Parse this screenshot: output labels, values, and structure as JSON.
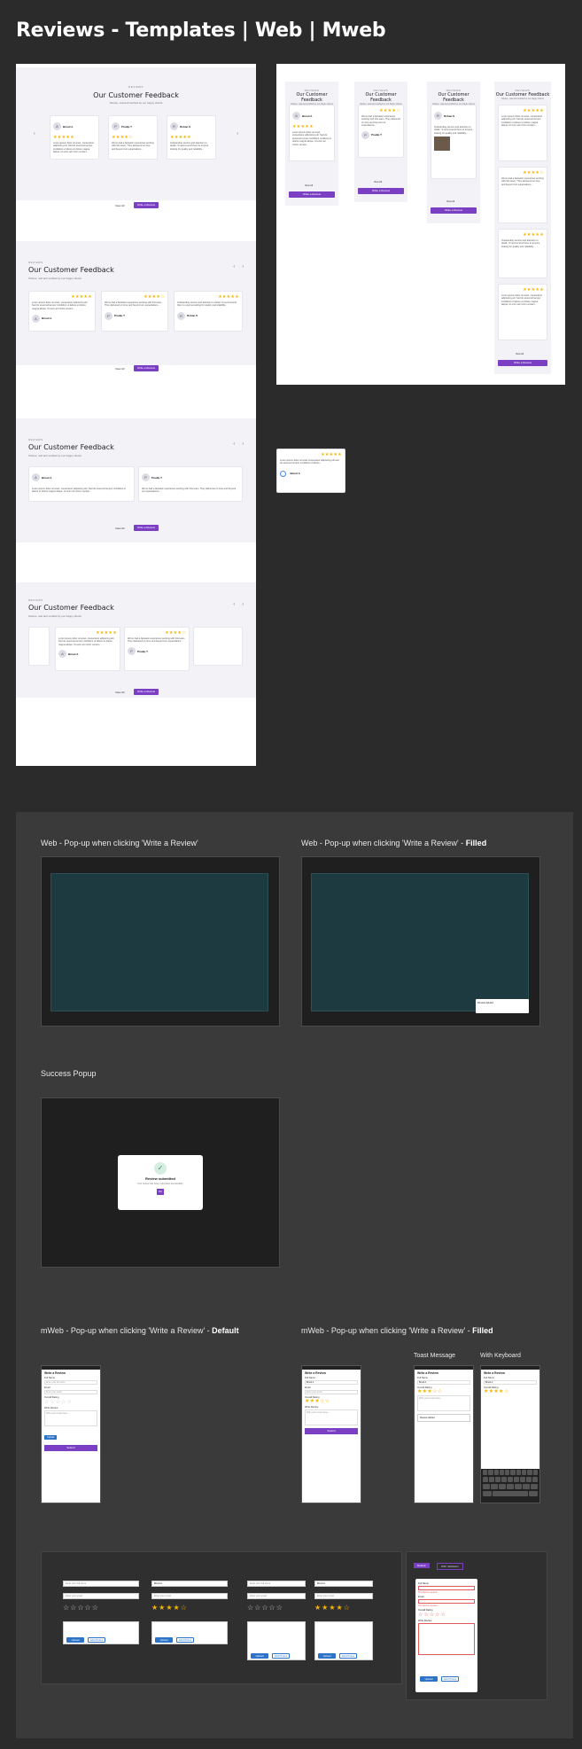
{
  "page": {
    "title": "Reviews - Templates | Web | Mweb"
  },
  "review_block": {
    "eyebrow": "REVIEWS",
    "title": "Our Customer Feedback",
    "subtitle": "Stories, real and verified by our happy clients",
    "view_all": "View All",
    "write_review": "Write a Review",
    "read_more": "Read more"
  },
  "reviewers": [
    {
      "name": "Binod A",
      "initial": "A",
      "rating": "★★★★★",
      "text": "Lorem ipsum dolor sit amet, consectetur adipiscing elit. Sed do eiusmod tempor incididunt ut labore et dolore magna aliqua. Ut enim ad minim veniam..."
    },
    {
      "name": "Pradip T",
      "initial": "P",
      "rating": "★★★★☆",
      "text": "We've had a fantastic experience working with this team. They delivered on time and beyond our expectations..."
    },
    {
      "name": "Rohan S",
      "initial": "R",
      "rating": "★★★★★",
      "text": "Outstanding service and attention to detail. I'd recommend them to anyone looking for quality and reliability..."
    }
  ],
  "google_card": {
    "name": "Binod A",
    "rating": "★★★★★",
    "text": "Lorem ipsum dolor sit amet consectetur adipiscing elit sed do eiusmod tempor incididunt ut labore..."
  },
  "dark_section": {
    "popup_default_label": "Web - Pop-up when clicking 'Write a Review'",
    "popup_filled_label": "Web - Pop-up when clicking 'Write a Review' - ",
    "filled_word": "Filled",
    "success_label": "Success Popup",
    "success_title": "Review submitted",
    "success_text": "Your review has been submitted successfully.",
    "success_ok": "OK",
    "mweb_default_label": "mWeb - Pop-up when clicking 'Write a Review' - ",
    "default_word": "Default",
    "mweb_filled_label": "mWeb - Pop-up when clicking 'Write a Review' - ",
    "toast_label": "Toast Message",
    "keyboard_label": "With Keyboard",
    "toast_text": "Review Added"
  },
  "form": {
    "heading": "Write a Review",
    "full_name": "Full Name",
    "email": "Email",
    "overall_rating": "Overall Rating",
    "write_review": "Write Review",
    "name_value": "Binod A",
    "placeholder_name": "Enter your full name",
    "placeholder_email": "Enter your email",
    "placeholder_review": "Write your review here...",
    "upload": "Upload",
    "add_photos": "Add Photos",
    "submit": "Submit",
    "cancel": "Cancel",
    "error_text": "This field is required"
  },
  "tabs": {
    "tab1": "Default",
    "tab2": "With Validation"
  }
}
